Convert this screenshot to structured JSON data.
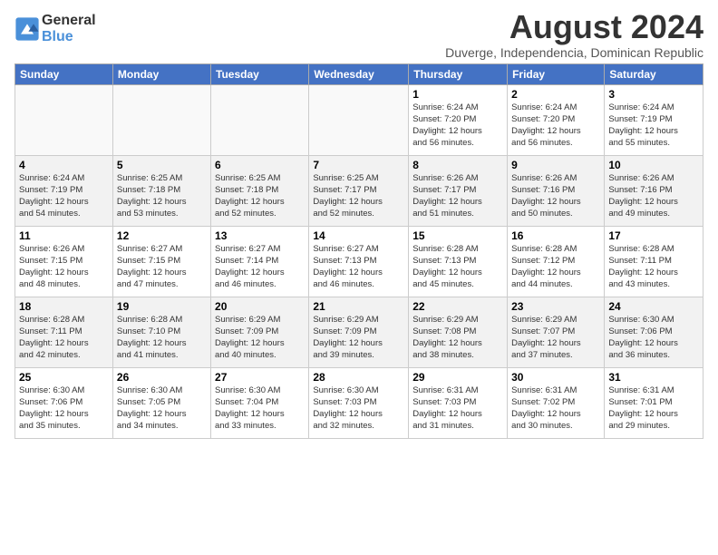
{
  "logo": {
    "line1": "General",
    "line2": "Blue"
  },
  "title": "August 2024",
  "location": "Duverge, Independencia, Dominican Republic",
  "headers": [
    "Sunday",
    "Monday",
    "Tuesday",
    "Wednesday",
    "Thursday",
    "Friday",
    "Saturday"
  ],
  "weeks": [
    [
      {
        "day": "",
        "detail": ""
      },
      {
        "day": "",
        "detail": ""
      },
      {
        "day": "",
        "detail": ""
      },
      {
        "day": "",
        "detail": ""
      },
      {
        "day": "1",
        "detail": "Sunrise: 6:24 AM\nSunset: 7:20 PM\nDaylight: 12 hours\nand 56 minutes."
      },
      {
        "day": "2",
        "detail": "Sunrise: 6:24 AM\nSunset: 7:20 PM\nDaylight: 12 hours\nand 56 minutes."
      },
      {
        "day": "3",
        "detail": "Sunrise: 6:24 AM\nSunset: 7:19 PM\nDaylight: 12 hours\nand 55 minutes."
      }
    ],
    [
      {
        "day": "4",
        "detail": "Sunrise: 6:24 AM\nSunset: 7:19 PM\nDaylight: 12 hours\nand 54 minutes."
      },
      {
        "day": "5",
        "detail": "Sunrise: 6:25 AM\nSunset: 7:18 PM\nDaylight: 12 hours\nand 53 minutes."
      },
      {
        "day": "6",
        "detail": "Sunrise: 6:25 AM\nSunset: 7:18 PM\nDaylight: 12 hours\nand 52 minutes."
      },
      {
        "day": "7",
        "detail": "Sunrise: 6:25 AM\nSunset: 7:17 PM\nDaylight: 12 hours\nand 52 minutes."
      },
      {
        "day": "8",
        "detail": "Sunrise: 6:26 AM\nSunset: 7:17 PM\nDaylight: 12 hours\nand 51 minutes."
      },
      {
        "day": "9",
        "detail": "Sunrise: 6:26 AM\nSunset: 7:16 PM\nDaylight: 12 hours\nand 50 minutes."
      },
      {
        "day": "10",
        "detail": "Sunrise: 6:26 AM\nSunset: 7:16 PM\nDaylight: 12 hours\nand 49 minutes."
      }
    ],
    [
      {
        "day": "11",
        "detail": "Sunrise: 6:26 AM\nSunset: 7:15 PM\nDaylight: 12 hours\nand 48 minutes."
      },
      {
        "day": "12",
        "detail": "Sunrise: 6:27 AM\nSunset: 7:15 PM\nDaylight: 12 hours\nand 47 minutes."
      },
      {
        "day": "13",
        "detail": "Sunrise: 6:27 AM\nSunset: 7:14 PM\nDaylight: 12 hours\nand 46 minutes."
      },
      {
        "day": "14",
        "detail": "Sunrise: 6:27 AM\nSunset: 7:13 PM\nDaylight: 12 hours\nand 46 minutes."
      },
      {
        "day": "15",
        "detail": "Sunrise: 6:28 AM\nSunset: 7:13 PM\nDaylight: 12 hours\nand 45 minutes."
      },
      {
        "day": "16",
        "detail": "Sunrise: 6:28 AM\nSunset: 7:12 PM\nDaylight: 12 hours\nand 44 minutes."
      },
      {
        "day": "17",
        "detail": "Sunrise: 6:28 AM\nSunset: 7:11 PM\nDaylight: 12 hours\nand 43 minutes."
      }
    ],
    [
      {
        "day": "18",
        "detail": "Sunrise: 6:28 AM\nSunset: 7:11 PM\nDaylight: 12 hours\nand 42 minutes."
      },
      {
        "day": "19",
        "detail": "Sunrise: 6:28 AM\nSunset: 7:10 PM\nDaylight: 12 hours\nand 41 minutes."
      },
      {
        "day": "20",
        "detail": "Sunrise: 6:29 AM\nSunset: 7:09 PM\nDaylight: 12 hours\nand 40 minutes."
      },
      {
        "day": "21",
        "detail": "Sunrise: 6:29 AM\nSunset: 7:09 PM\nDaylight: 12 hours\nand 39 minutes."
      },
      {
        "day": "22",
        "detail": "Sunrise: 6:29 AM\nSunset: 7:08 PM\nDaylight: 12 hours\nand 38 minutes."
      },
      {
        "day": "23",
        "detail": "Sunrise: 6:29 AM\nSunset: 7:07 PM\nDaylight: 12 hours\nand 37 minutes."
      },
      {
        "day": "24",
        "detail": "Sunrise: 6:30 AM\nSunset: 7:06 PM\nDaylight: 12 hours\nand 36 minutes."
      }
    ],
    [
      {
        "day": "25",
        "detail": "Sunrise: 6:30 AM\nSunset: 7:06 PM\nDaylight: 12 hours\nand 35 minutes."
      },
      {
        "day": "26",
        "detail": "Sunrise: 6:30 AM\nSunset: 7:05 PM\nDaylight: 12 hours\nand 34 minutes."
      },
      {
        "day": "27",
        "detail": "Sunrise: 6:30 AM\nSunset: 7:04 PM\nDaylight: 12 hours\nand 33 minutes."
      },
      {
        "day": "28",
        "detail": "Sunrise: 6:30 AM\nSunset: 7:03 PM\nDaylight: 12 hours\nand 32 minutes."
      },
      {
        "day": "29",
        "detail": "Sunrise: 6:31 AM\nSunset: 7:03 PM\nDaylight: 12 hours\nand 31 minutes."
      },
      {
        "day": "30",
        "detail": "Sunrise: 6:31 AM\nSunset: 7:02 PM\nDaylight: 12 hours\nand 30 minutes."
      },
      {
        "day": "31",
        "detail": "Sunrise: 6:31 AM\nSunset: 7:01 PM\nDaylight: 12 hours\nand 29 minutes."
      }
    ]
  ]
}
